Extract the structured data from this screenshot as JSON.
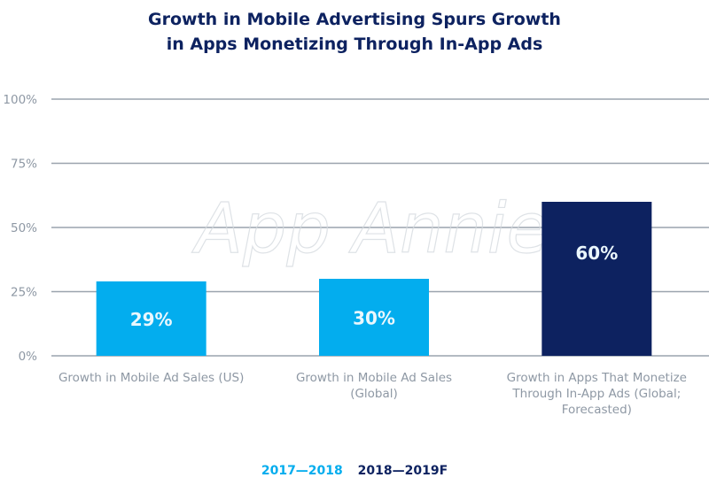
{
  "title_line1": "Growth in Mobile Advertising Spurs Growth",
  "title_line2": "in Apps Monetizing Through In-App Ads",
  "watermark": "App Annie",
  "colors": {
    "series1": "#03adee",
    "series2": "#0d2260",
    "axis_text": "#8e98a4",
    "grid": "#9aa3ad"
  },
  "chart_data": {
    "type": "bar",
    "title": "Growth in Mobile Advertising Spurs Growth in Apps Monetizing Through In-App Ads",
    "categories": [
      "Growth in Mobile Ad Sales (US)",
      "Growth in Mobile Ad Sales (Global)",
      "Growth in Apps That Monetize Through In-App Ads (Global; Forecasted)"
    ],
    "category_lines": [
      [
        "Growth in Mobile Ad Sales (US)"
      ],
      [
        "Growth in Mobile Ad Sales",
        "(Global)"
      ],
      [
        "Growth in Apps That Monetize",
        "Through In-App Ads (Global;",
        "Forecasted)"
      ]
    ],
    "values": [
      29,
      30,
      60
    ],
    "data_labels": [
      "29%",
      "30%",
      "60%"
    ],
    "bar_series": [
      "2017—2018",
      "2017—2018",
      "2018—2019F"
    ],
    "legend": [
      "2017—2018",
      "2018—2019F"
    ],
    "legend_placement": "bottom",
    "yticks": [
      "0%",
      "25%",
      "50%",
      "75%",
      "100%"
    ],
    "ylim": [
      0,
      100
    ],
    "grid": true
  }
}
